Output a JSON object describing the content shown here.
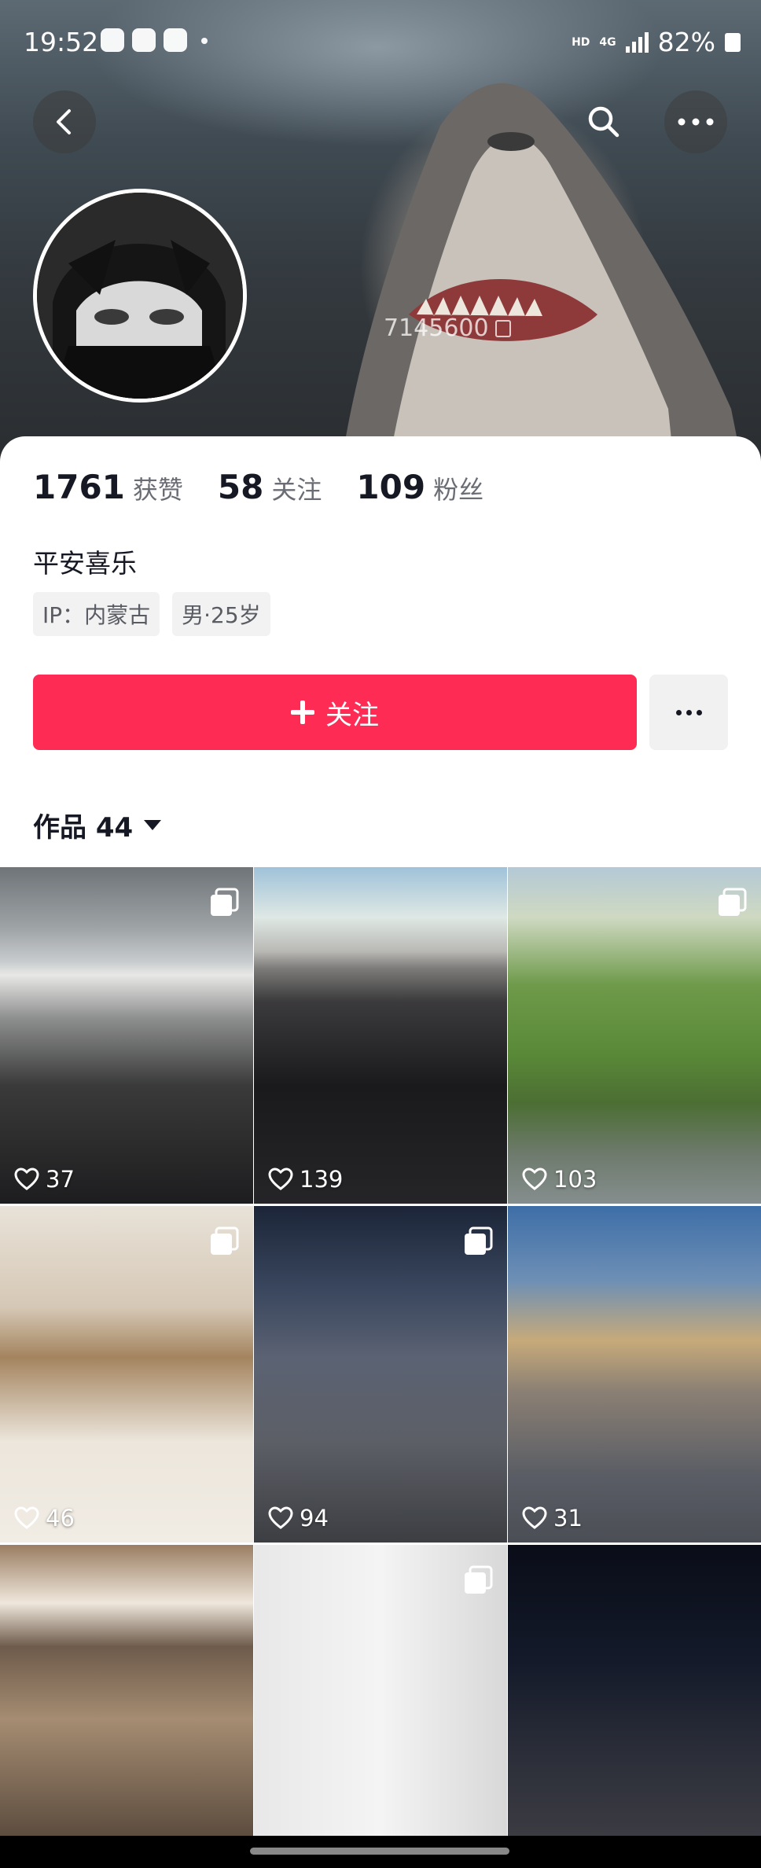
{
  "status_bar": {
    "time": "19:52",
    "network_hd": "HD",
    "network_4g": "4G",
    "battery": "82%"
  },
  "profile": {
    "user_id": "7145600",
    "stats": [
      {
        "value": "1761",
        "label": "获赞"
      },
      {
        "value": "58",
        "label": "关注"
      },
      {
        "value": "109",
        "label": "粉丝"
      }
    ],
    "nickname": "平安喜乐",
    "tags": [
      "IP：内蒙古",
      "男·25岁"
    ],
    "follow_label": "关注"
  },
  "works": {
    "tab_label": "作品 44",
    "items": [
      {
        "likes": "37",
        "multi": true
      },
      {
        "likes": "139",
        "multi": false
      },
      {
        "likes": "103",
        "multi": true
      },
      {
        "likes": "46",
        "multi": true
      },
      {
        "likes": "94",
        "multi": true
      },
      {
        "likes": "31",
        "multi": false
      },
      {
        "likes": "",
        "multi": false
      },
      {
        "likes": "",
        "multi": true
      },
      {
        "likes": "",
        "multi": false
      }
    ]
  },
  "icons": {
    "back": "back-arrow-icon",
    "search": "search-icon",
    "more": "more-dots-icon",
    "copy": "copy-icon",
    "heart": "heart-outline-icon",
    "multi": "multi-image-icon"
  },
  "colors": {
    "accent": "#fe2c55",
    "text_primary": "#161823",
    "text_secondary": "#6b6d75"
  }
}
